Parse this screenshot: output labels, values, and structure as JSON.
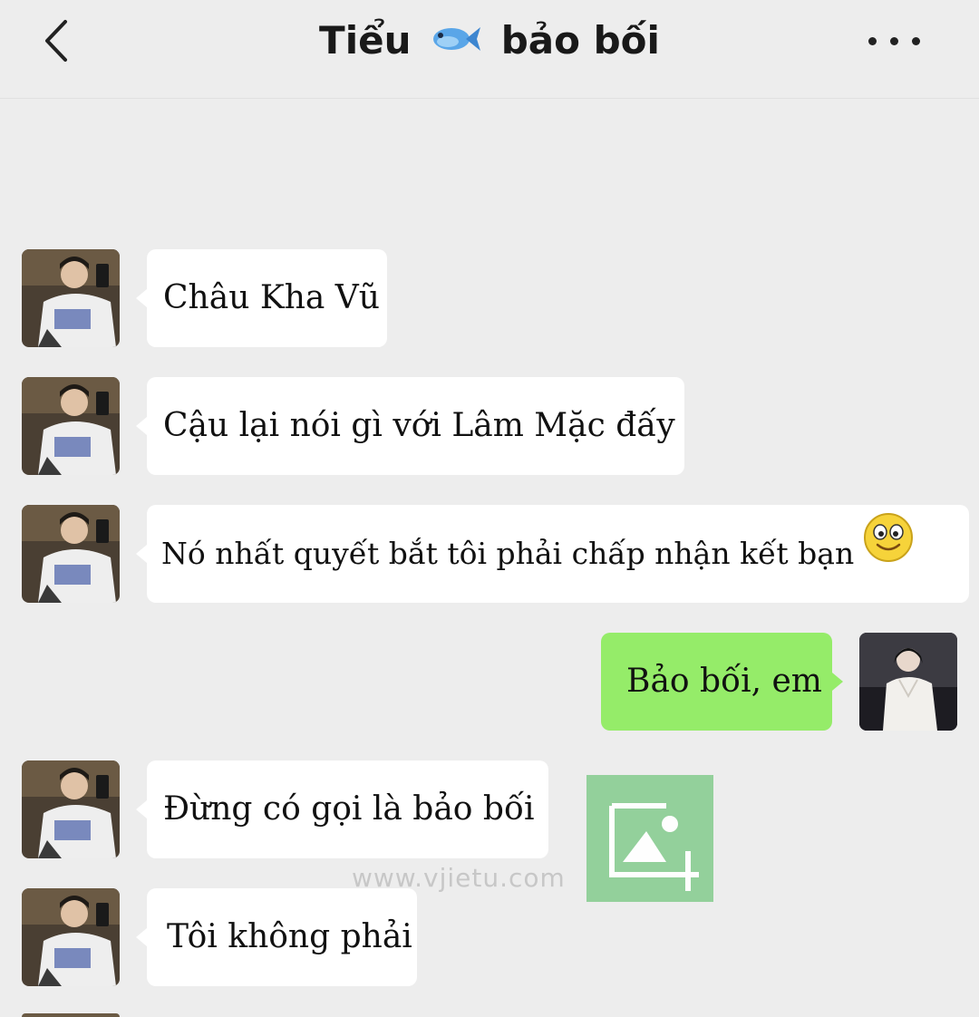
{
  "header": {
    "title_before": "Tiểu",
    "title_after": "bảo bối"
  },
  "messages": [
    {
      "side": "left",
      "text": "Châu Kha Vũ"
    },
    {
      "side": "left",
      "text": "Cậu lại nói gì với Lâm Mặc đấy"
    },
    {
      "side": "left",
      "text": "Nó nhất quyết bắt tôi phải chấp nhận kết bạn"
    },
    {
      "side": "right",
      "text": "Bảo bối, em"
    },
    {
      "side": "left",
      "text": "Đừng có gọi là bảo bối"
    },
    {
      "side": "left",
      "text": "Tôi không phải"
    }
  ],
  "watermark": "www.vjietu.com",
  "colors": {
    "background": "#ededed",
    "incoming_bubble": "#ffffff",
    "outgoing_bubble": "#95ec69",
    "watermark_icon": "#8fcf97"
  },
  "icons": {
    "back": "chevron-left-icon",
    "more": "more-dots-icon",
    "title_emoji": "fish-icon",
    "message_emoji": "smile-emoji-icon"
  }
}
